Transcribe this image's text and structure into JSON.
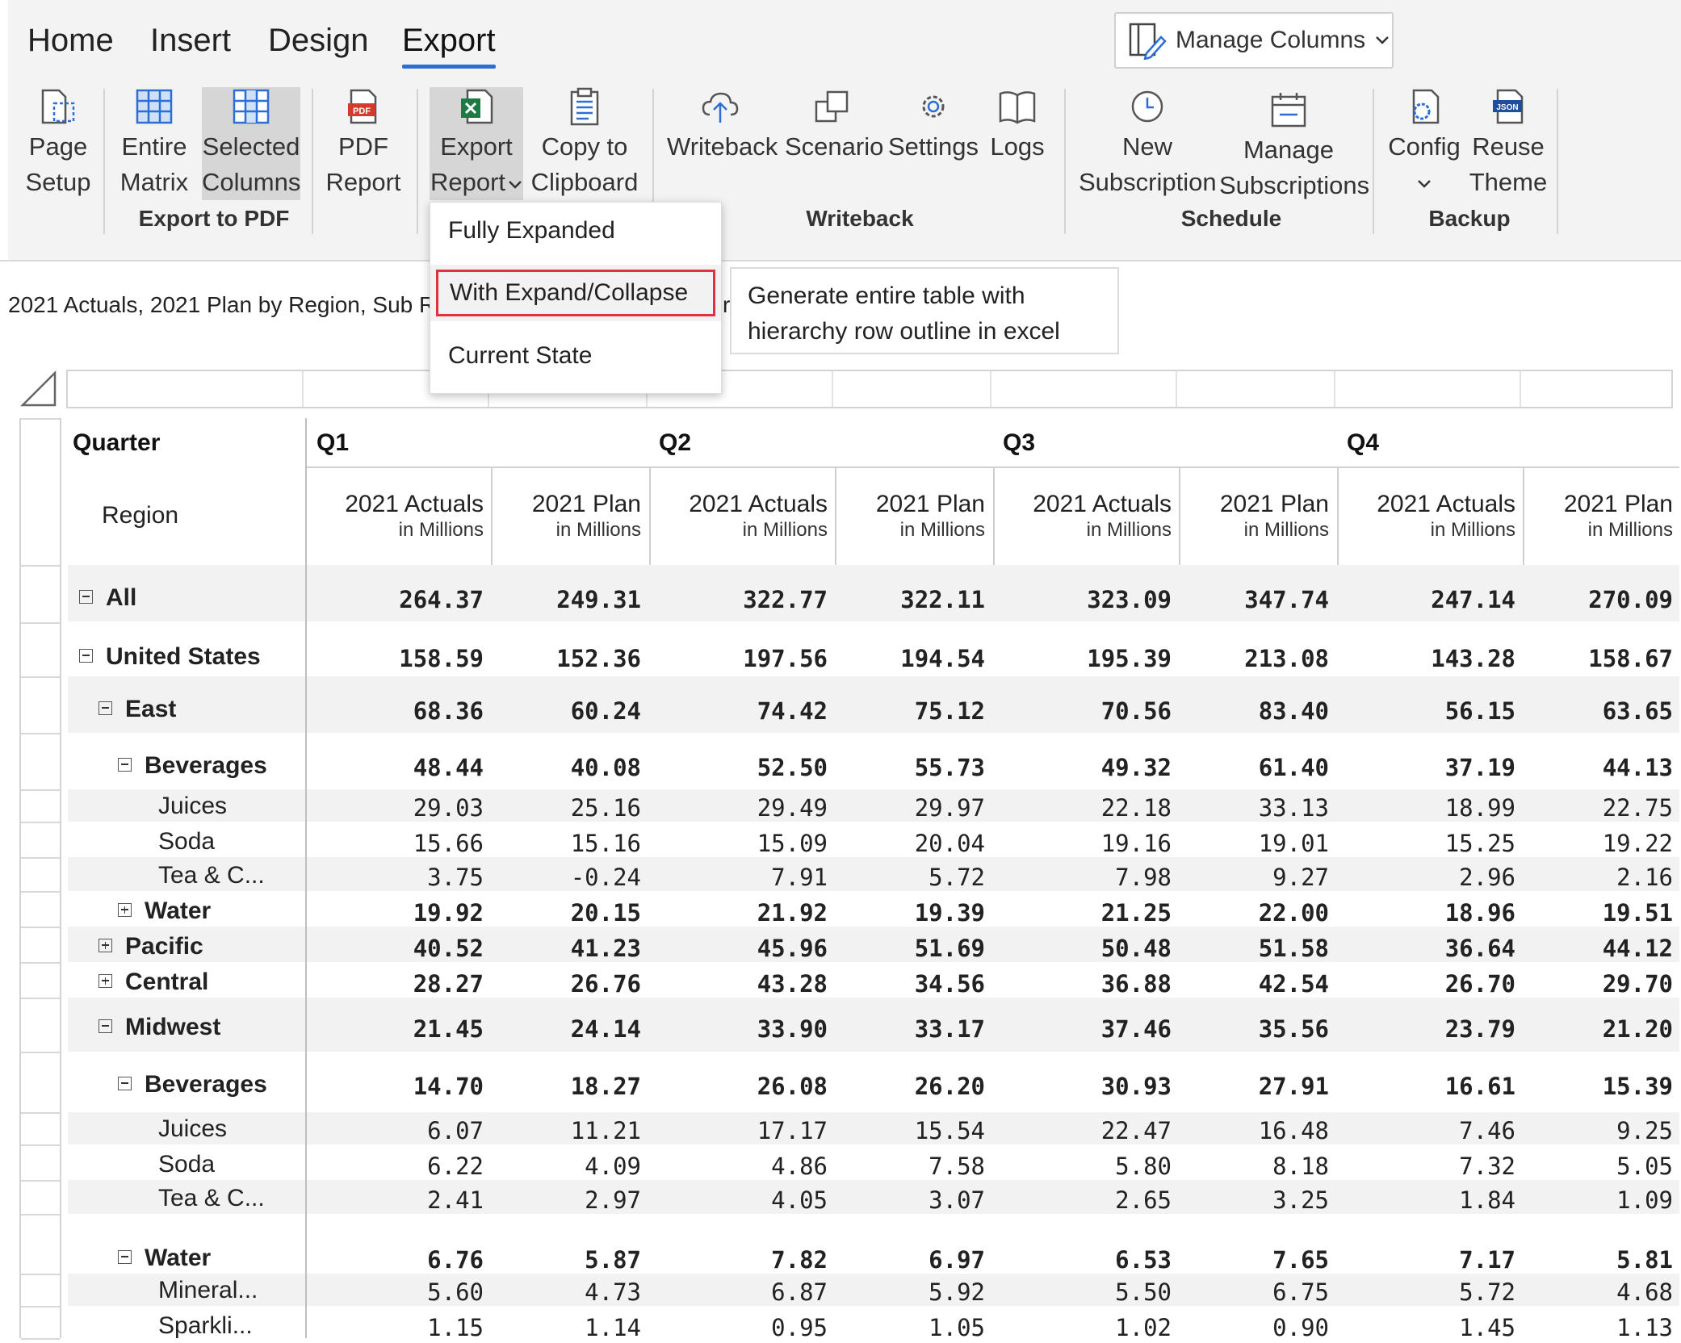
{
  "menu": {
    "tabs": [
      "Home",
      "Insert",
      "Design",
      "Export"
    ],
    "active": "Export"
  },
  "manage_columns": {
    "label": "Manage Columns"
  },
  "ribbon": {
    "page_setup": [
      "Page",
      "Setup"
    ],
    "entire_matrix": [
      "Entire",
      "Matrix"
    ],
    "selected_columns": [
      "Selected",
      "Columns"
    ],
    "pdf_report": [
      "PDF",
      "Report"
    ],
    "export_report": [
      "Export",
      "Report"
    ],
    "copy_clipboard": [
      "Copy to",
      "Clipboard"
    ],
    "writeback": "Writeback",
    "scenario": "Scenario",
    "settings": "Settings",
    "logs": "Logs",
    "new_subscription": [
      "New",
      "Subscription"
    ],
    "manage_subscriptions": [
      "Manage",
      "Subscriptions"
    ],
    "config": "Config",
    "reuse_theme": [
      "Reuse",
      "Theme"
    ],
    "pdf_icon_text": "PDF",
    "json_icon_text": "JSON",
    "groups": {
      "export_pdf": "Export to PDF",
      "writeback": "Writeback",
      "schedule": "Schedule",
      "backup": "Backup"
    }
  },
  "table_title": "2021 Actuals, 2021 Plan by Region, Sub R",
  "title_cut": "r",
  "dropdown": {
    "items": [
      "Fully Expanded",
      "With Expand/Collapse",
      "Current State"
    ]
  },
  "tooltip": [
    "Generate entire table with",
    "hierarchy row outline in excel"
  ],
  "grid": {
    "quarter_label": "Quarter",
    "region_label": "Region",
    "quarters": [
      "Q1",
      "Q2",
      "Q3",
      "Q4"
    ],
    "measure_top": [
      "2021 Actuals",
      "2021 Plan"
    ],
    "measure_sub": "in Millions",
    "rows": [
      {
        "label": "All",
        "bold": true,
        "level": 0,
        "toggle": "minus",
        "values": [
          "264.37",
          "249.31",
          "322.77",
          "322.11",
          "323.09",
          "347.74",
          "247.14",
          "270.09"
        ]
      },
      {
        "label": "United States",
        "bold": true,
        "level": 0,
        "toggle": "minus",
        "values": [
          "158.59",
          "152.36",
          "197.56",
          "194.54",
          "195.39",
          "213.08",
          "143.28",
          "158.67"
        ]
      },
      {
        "label": "East",
        "bold": true,
        "level": 1,
        "toggle": "minus",
        "values": [
          "68.36",
          "60.24",
          "74.42",
          "75.12",
          "70.56",
          "83.40",
          "56.15",
          "63.65"
        ]
      },
      {
        "label": "Beverages",
        "bold": true,
        "level": 2,
        "toggle": "minus",
        "values": [
          "48.44",
          "40.08",
          "52.50",
          "55.73",
          "49.32",
          "61.40",
          "37.19",
          "44.13"
        ]
      },
      {
        "label": "Juices",
        "bold": false,
        "level": 3,
        "toggle": "",
        "values": [
          "29.03",
          "25.16",
          "29.49",
          "29.97",
          "22.18",
          "33.13",
          "18.99",
          "22.75"
        ]
      },
      {
        "label": "Soda",
        "bold": false,
        "level": 3,
        "toggle": "",
        "values": [
          "15.66",
          "15.16",
          "15.09",
          "20.04",
          "19.16",
          "19.01",
          "15.25",
          "19.22"
        ]
      },
      {
        "label": "Tea & C...",
        "bold": false,
        "level": 3,
        "toggle": "",
        "values": [
          "3.75",
          "-0.24",
          "7.91",
          "5.72",
          "7.98",
          "9.27",
          "2.96",
          "2.16"
        ]
      },
      {
        "label": "Water",
        "bold": true,
        "level": 2,
        "toggle": "plus",
        "values": [
          "19.92",
          "20.15",
          "21.92",
          "19.39",
          "21.25",
          "22.00",
          "18.96",
          "19.51"
        ]
      },
      {
        "label": "Pacific",
        "bold": true,
        "level": 1,
        "toggle": "plus",
        "values": [
          "40.52",
          "41.23",
          "45.96",
          "51.69",
          "50.48",
          "51.58",
          "36.64",
          "44.12"
        ]
      },
      {
        "label": "Central",
        "bold": true,
        "level": 1,
        "toggle": "plus",
        "values": [
          "28.27",
          "26.76",
          "43.28",
          "34.56",
          "36.88",
          "42.54",
          "26.70",
          "29.70"
        ]
      },
      {
        "label": "Midwest",
        "bold": true,
        "level": 1,
        "toggle": "minus",
        "values": [
          "21.45",
          "24.14",
          "33.90",
          "33.17",
          "37.46",
          "35.56",
          "23.79",
          "21.20"
        ]
      },
      {
        "label": "Beverages",
        "bold": true,
        "level": 2,
        "toggle": "minus",
        "values": [
          "14.70",
          "18.27",
          "26.08",
          "26.20",
          "30.93",
          "27.91",
          "16.61",
          "15.39"
        ]
      },
      {
        "label": "Juices",
        "bold": false,
        "level": 3,
        "toggle": "",
        "values": [
          "6.07",
          "11.21",
          "17.17",
          "15.54",
          "22.47",
          "16.48",
          "7.46",
          "9.25"
        ]
      },
      {
        "label": "Soda",
        "bold": false,
        "level": 3,
        "toggle": "",
        "values": [
          "6.22",
          "4.09",
          "4.86",
          "7.58",
          "5.80",
          "8.18",
          "7.32",
          "5.05"
        ]
      },
      {
        "label": "Tea & C...",
        "bold": false,
        "level": 3,
        "toggle": "",
        "values": [
          "2.41",
          "2.97",
          "4.05",
          "3.07",
          "2.65",
          "3.25",
          "1.84",
          "1.09"
        ]
      },
      {
        "label": "Water",
        "bold": true,
        "level": 2,
        "toggle": "minus",
        "values": [
          "6.76",
          "5.87",
          "7.82",
          "6.97",
          "6.53",
          "7.65",
          "7.17",
          "5.81"
        ]
      },
      {
        "label": "Mineral...",
        "bold": false,
        "level": 3,
        "toggle": "",
        "values": [
          "5.60",
          "4.73",
          "6.87",
          "5.92",
          "5.50",
          "6.75",
          "5.72",
          "4.68"
        ]
      },
      {
        "label": "Sparkli...",
        "bold": false,
        "level": 3,
        "toggle": "",
        "values": [
          "1.15",
          "1.14",
          "0.95",
          "1.05",
          "1.02",
          "0.90",
          "1.45",
          "1.13"
        ]
      }
    ]
  }
}
